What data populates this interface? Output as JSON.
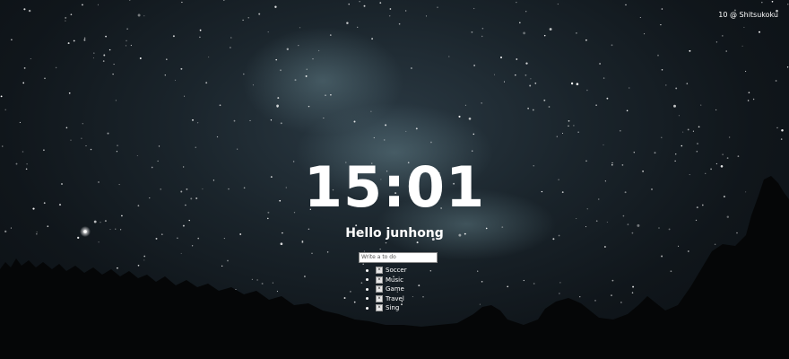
{
  "weather": {
    "text": "10 @ Shitsukoku"
  },
  "clock": {
    "time": "15:01"
  },
  "greeting": {
    "text": "Hello junhong"
  },
  "todo": {
    "placeholder": "Write a to do",
    "delete_label": "×",
    "items": [
      {
        "label": "Soccer"
      },
      {
        "label": "Music"
      },
      {
        "label": "Game"
      },
      {
        "label": "Travel"
      },
      {
        "label": "Sing"
      }
    ]
  }
}
